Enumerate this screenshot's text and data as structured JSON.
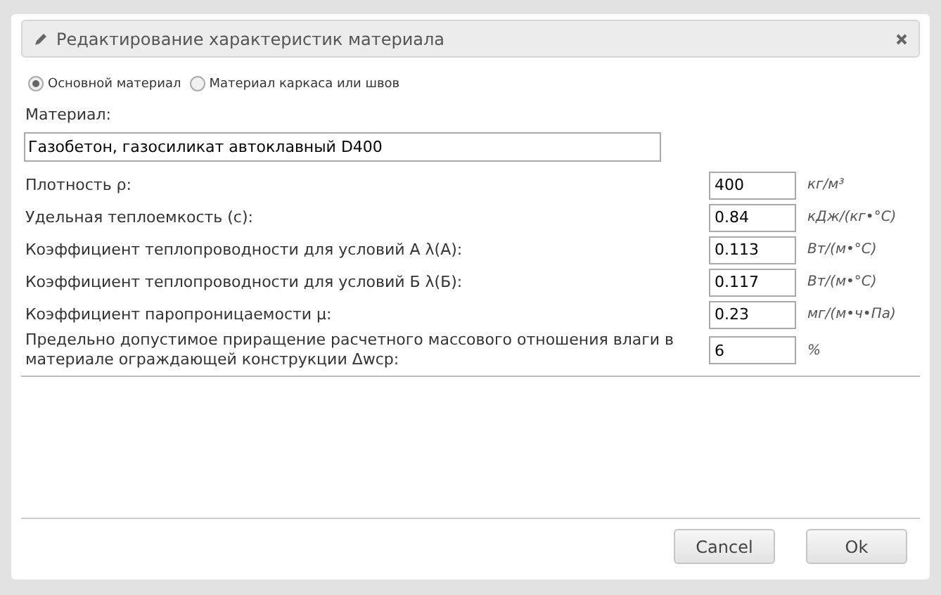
{
  "dialog": {
    "title": "Редактирование характеристик материала",
    "material_type": [
      {
        "label": "Основной материал",
        "selected": true
      },
      {
        "label": "Материал каркаса или швов",
        "selected": false
      }
    ],
    "material": {
      "label": "Материал:",
      "value": "Газобетон, газосиликат автоклавный D400"
    },
    "properties": [
      {
        "label": "Плотность ρ:",
        "value": "400",
        "unit": "кг/м³"
      },
      {
        "label": "Удельная теплоемкость (c):",
        "value": "0.84",
        "unit": "кДж/(кг•°C)"
      },
      {
        "label": "Коэффициент теплопроводности для условий А λ(А):",
        "value": "0.113",
        "unit": "Вт/(м•°C)"
      },
      {
        "label": "Коэффициент теплопроводности для условий Б λ(Б):",
        "value": "0.117",
        "unit": "Вт/(м•°C)"
      },
      {
        "label": "Коэффициент паропроницаемости μ:",
        "value": "0.23",
        "unit": "мг/(м•ч•Па)"
      },
      {
        "label": "Предельно допустимое приращение расчетного массового отношения влаги в материале ограждающей конструкции Δwср:",
        "value": "6",
        "unit": "%"
      }
    ],
    "buttons": [
      "Cancel",
      "Ok"
    ]
  }
}
